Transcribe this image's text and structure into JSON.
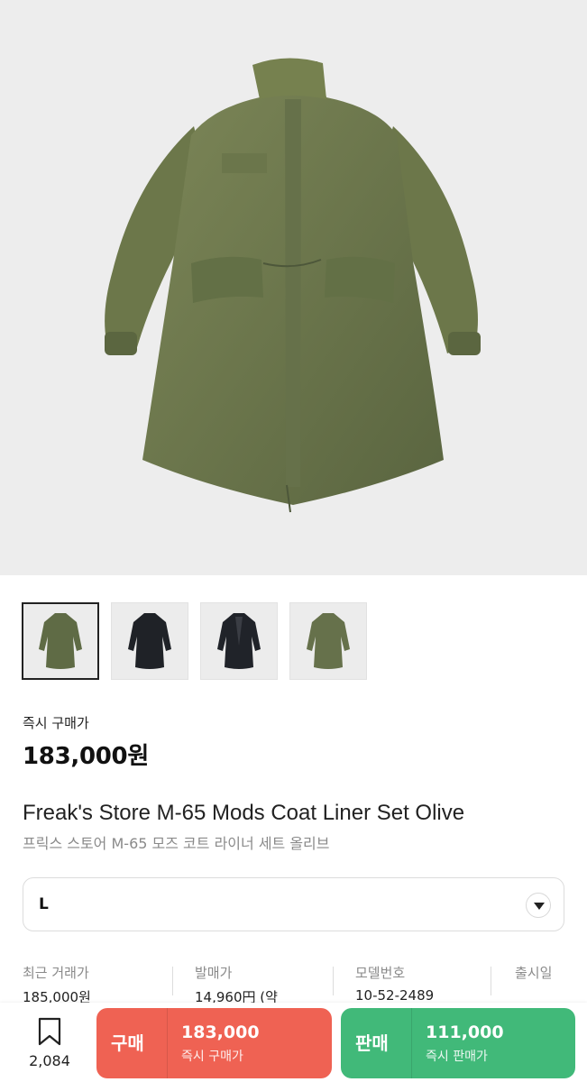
{
  "product": {
    "main_image_icon": "olive-mods-coat-image",
    "thumbnails": [
      {
        "icon": "olive-coat-thumbnail",
        "color": "#5f6b45",
        "selected": true
      },
      {
        "icon": "black-coat-front-thumbnail",
        "color": "#1f2227",
        "selected": false
      },
      {
        "icon": "black-coat-open-thumbnail",
        "color": "#202329",
        "selected": false
      },
      {
        "icon": "olive-coat-thumbnail",
        "color": "#66714b",
        "selected": false
      }
    ],
    "price_label": "즉시 구매가",
    "price": "183,000원",
    "title_en": "Freak's Store M-65 Mods Coat Liner Set Olive",
    "title_ko": "프릭스 스토어 M-65 모즈 코트 라이너 세트 올리브"
  },
  "size_select": {
    "value": "L",
    "caret_icon": "chevron-down-icon"
  },
  "info": {
    "recent_price_label": "최근 거래가",
    "recent_price_value": "185,000원",
    "release_price_label": "발매가",
    "release_price_value": "14,960円 (약",
    "model_no_label": "모델번호",
    "model_no_value": "10-52-2489",
    "release_date_label": "출시일"
  },
  "bottom_bar": {
    "wish_count": "2,084",
    "wish_icon": "bookmark-icon",
    "buy": {
      "label": "구매",
      "price": "183,000",
      "sub": "즉시 구매가",
      "color": "#ef6253"
    },
    "sell": {
      "label": "판매",
      "price": "111,000",
      "sub": "즉시 판매가",
      "color": "#41b979"
    }
  }
}
